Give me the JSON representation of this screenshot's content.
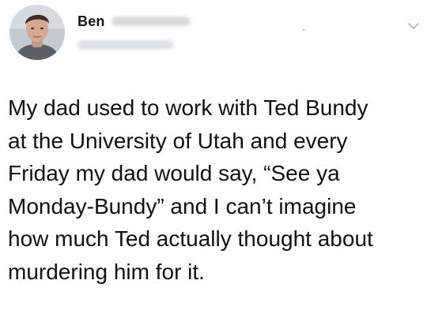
{
  "author": {
    "display_name": "Ben"
  },
  "tweet": {
    "text": "My dad used to work with Ted Bundy\nat the University of Utah and every\nFriday my dad would say, “See ya\nMonday-Bundy” and I can’t imagine\nhow much Ted actually thought about\nmurdering him for it."
  },
  "icons": {
    "avatar": "profile-photo",
    "menu": "chevron-down-icon"
  },
  "colors": {
    "text": "#111111",
    "name": "#14171a",
    "chevron": "#b0b6bb"
  }
}
